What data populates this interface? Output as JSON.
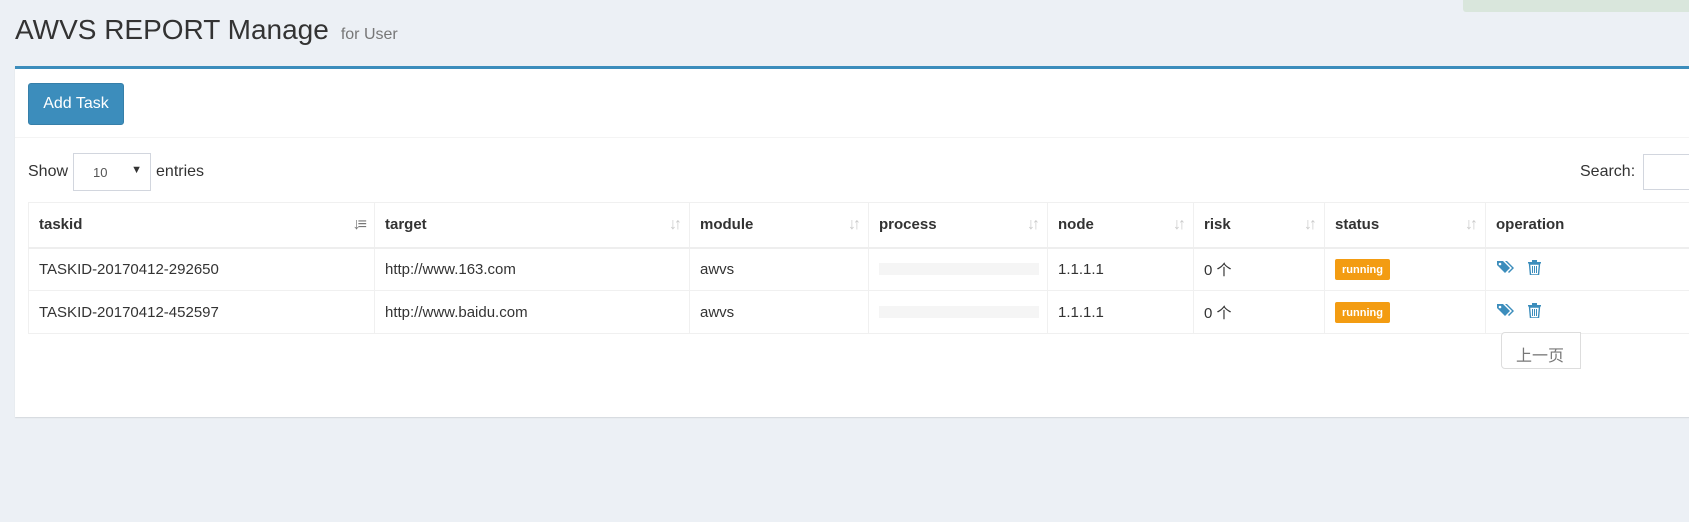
{
  "header": {
    "title": "AWVS REPORT Manage",
    "subtitle": "for User"
  },
  "toolbar": {
    "add_task_label": "Add Task"
  },
  "length_menu": {
    "prefix": "Show",
    "selected": "10",
    "suffix": "entries"
  },
  "search": {
    "label": "Search:",
    "value": ""
  },
  "table": {
    "columns": [
      "taskid",
      "target",
      "module",
      "process",
      "node",
      "risk",
      "status",
      "operation"
    ],
    "rows": [
      {
        "taskid": "TASKID-20170412-292650",
        "target": "http://www.163.com",
        "module": "awvs",
        "process": 0,
        "node": "1.1.1.1",
        "risk": "0 个",
        "status": "running"
      },
      {
        "taskid": "TASKID-20170412-452597",
        "target": "http://www.baidu.com",
        "module": "awvs",
        "process": 0,
        "node": "1.1.1.1",
        "risk": "0 个",
        "status": "running"
      }
    ]
  },
  "pagination": {
    "previous_label": "上一页"
  },
  "colors": {
    "primary": "#3c8dbc",
    "status_running": "#f39c12",
    "background": "#ecf0f5"
  },
  "icons": {
    "operation": [
      "tags-icon",
      "trash-icon"
    ]
  }
}
